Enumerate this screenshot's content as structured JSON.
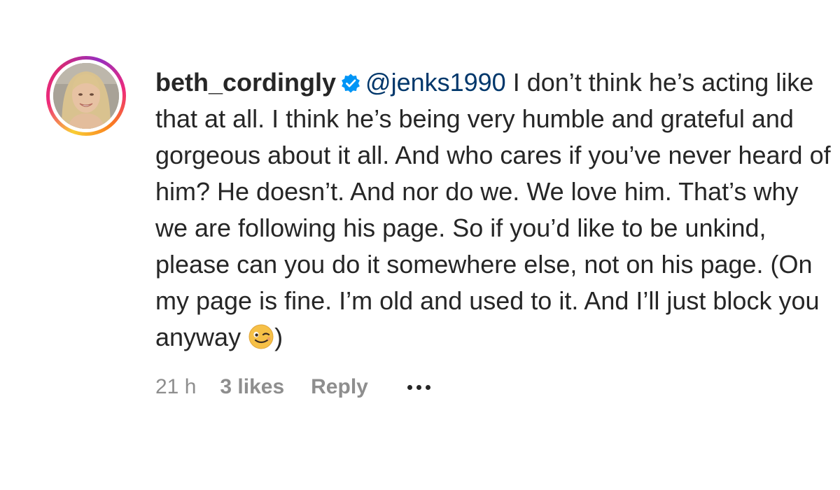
{
  "comment": {
    "username": "beth_cordingly",
    "verified_icon": "verified-badge-icon",
    "mention": "@jenks1990",
    "text": " I don’t think he’s acting like that at all. I think he’s being very humble and grateful and gorgeous about it all. And who cares if you’ve never heard of him? He doesn’t. And nor do we. We love him. That’s why we are following his page. So if you’d like to be unkind, please can you do it somewhere else, not on his page. (On my page is fine. I’m old and used to it. And I’ll just block you anyway ",
    "emoji_icon": "winking-face-emoji-icon",
    "closing": ")",
    "time": "21 h",
    "likes": "3 likes",
    "reply": "Reply",
    "more_icon": "more-options-icon"
  },
  "colors": {
    "text": "#262626",
    "mention": "#00376b",
    "meta": "#8e8e8e",
    "verified": "#0095f6"
  }
}
